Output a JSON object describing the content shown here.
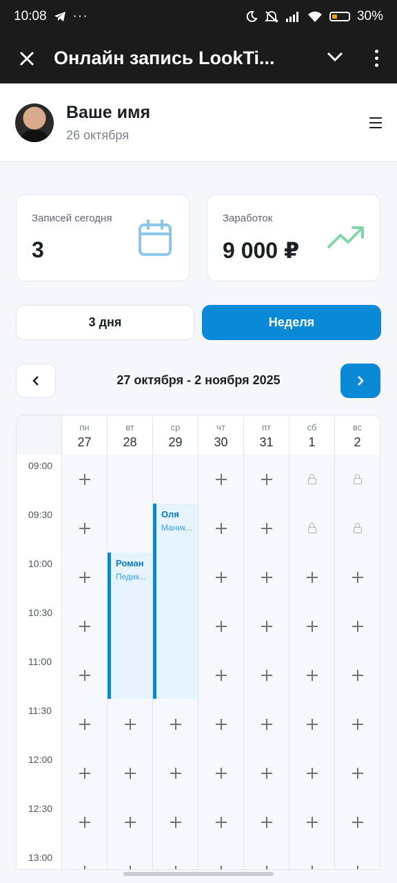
{
  "status_bar": {
    "time": "10:08",
    "battery": "30%",
    "battery_level": 0.3
  },
  "app_bar": {
    "title": "Онлайн запись LookTi..."
  },
  "profile": {
    "name": "Ваше имя",
    "date": "26 октября"
  },
  "stats": {
    "bookings_label": "Записей сегодня",
    "bookings_value": "3",
    "earnings_label": "Заработок",
    "earnings_value": "9 000 ₽"
  },
  "view_toggle": {
    "three_days": "3 дня",
    "week": "Неделя",
    "selected": "Неделя"
  },
  "range": {
    "label": "27 октября - 2 ноября 2025"
  },
  "calendar": {
    "days": [
      {
        "name": "пн",
        "num": "27"
      },
      {
        "name": "вт",
        "num": "28"
      },
      {
        "name": "ср",
        "num": "29"
      },
      {
        "name": "чт",
        "num": "30"
      },
      {
        "name": "пт",
        "num": "31"
      },
      {
        "name": "сб",
        "num": "1"
      },
      {
        "name": "вс",
        "num": "2"
      }
    ],
    "times": [
      "09:00",
      "09:30",
      "10:00",
      "10:30",
      "11:00",
      "11:30",
      "12:00",
      "12:30",
      "13:00"
    ],
    "slots": [
      [
        "plus",
        "empty",
        "empty",
        "plus",
        "plus",
        "lock",
        "lock"
      ],
      [
        "plus",
        "empty",
        "appt",
        "plus",
        "plus",
        "lock",
        "lock"
      ],
      [
        "plus",
        "appt",
        "appt",
        "plus",
        "plus",
        "plus",
        "plus"
      ],
      [
        "plus",
        "appt",
        "appt",
        "plus",
        "plus",
        "plus",
        "plus"
      ],
      [
        "plus",
        "appt",
        "appt",
        "plus",
        "plus",
        "plus",
        "plus"
      ],
      [
        "plus",
        "plus",
        "plus",
        "plus",
        "plus",
        "plus",
        "plus"
      ],
      [
        "plus",
        "plus",
        "plus",
        "plus",
        "plus",
        "plus",
        "plus"
      ],
      [
        "plus",
        "plus",
        "plus",
        "plus",
        "plus",
        "plus",
        "plus"
      ],
      [
        "plus",
        "plus",
        "plus",
        "plus",
        "plus",
        "plus",
        "plus"
      ]
    ],
    "appointments": [
      {
        "client": "Роман",
        "service": "Педик...",
        "day": 1,
        "start": "10:00",
        "end": "11:30"
      },
      {
        "client": "Оля",
        "service": "Маник...",
        "day": 2,
        "start": "09:30",
        "end": "11:30"
      }
    ]
  },
  "colors": {
    "accent": "#0a8ad6",
    "appointment_bg": "#e4f3fc",
    "trend": "#4cc38a"
  }
}
